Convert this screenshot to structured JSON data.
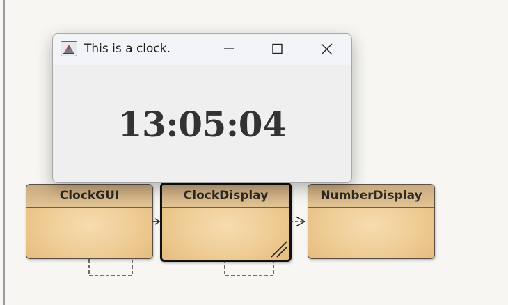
{
  "window": {
    "title": "This is a clock.",
    "time": "13:05:04",
    "controls": {
      "minimize": "minimize-icon",
      "maximize": "maximize-icon",
      "close": "close-icon"
    }
  },
  "diagram": {
    "classes": [
      {
        "name": "ClockGUI"
      },
      {
        "name": "ClockDisplay"
      },
      {
        "name": "NumberDisplay"
      }
    ]
  },
  "colors": {
    "class_fill": "#eecb93",
    "class_header": "#c9aa80",
    "window_bg": "#efefef",
    "canvas_bg": "#f7f6f2"
  }
}
